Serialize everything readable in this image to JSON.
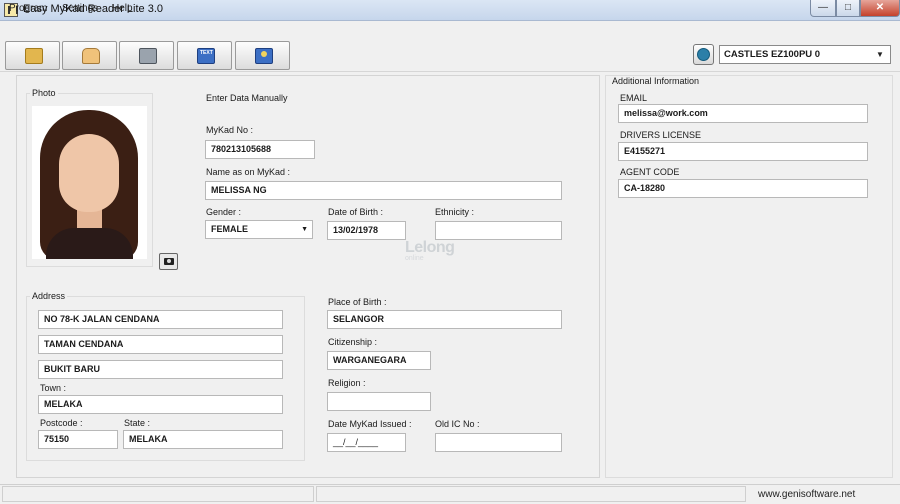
{
  "window": {
    "title": "Easy MyKad Reader Lite 3.0",
    "minimize": "—",
    "maximize": "□",
    "close": "✕"
  },
  "menu": [
    "Program",
    "Settings",
    "Help"
  ],
  "toolbar": {
    "buttons": [
      "card-reader-icon",
      "hand-card-icon",
      "printer-icon",
      "save-text-icon",
      "save-picture-icon"
    ],
    "save_text_glyph": "TEXT",
    "reader_select": "CASTLES EZ100PU 0"
  },
  "form": {
    "photo_label": "Photo",
    "enter_manually": "Enter Data Manually",
    "mykad_no_label": "MyKad No :",
    "mykad_no": "780213105688",
    "name_label": "Name as on MyKad :",
    "name": "MELISSA NG",
    "gender_label": "Gender :",
    "gender": "FEMALE",
    "dob_label": "Date of Birth :",
    "dob": "13/02/1978",
    "ethnicity_label": "Ethnicity :",
    "ethnicity": "",
    "address_label": "Address",
    "address1": "NO 78-K JALAN CENDANA",
    "address2": "TAMAN CENDANA",
    "address3": "BUKIT BARU",
    "town_label": "Town :",
    "town": "MELAKA",
    "postcode_label": "Postcode :",
    "postcode": "75150",
    "state_label": "State :",
    "state": "MELAKA",
    "pob_label": "Place of Birth :",
    "pob": "SELANGOR",
    "citizenship_label": "Citizenship :",
    "citizenship": "WARGANEGARA",
    "religion_label": "Religion :",
    "religion": "",
    "issued_label": "Date MyKad Issued :",
    "issued": "__/__/____",
    "oldic_label": "Old IC No :",
    "oldic": ""
  },
  "additional": {
    "title": "Additional Information",
    "email_label": "EMAIL",
    "email": "melissa@work.com",
    "license_label": "DRIVERS LICENSE",
    "license": "E4155271",
    "agent_label": "AGENT CODE",
    "agent": "CA-18280"
  },
  "watermark": {
    "main": "Lelong",
    "sub": "online"
  },
  "status": {
    "url": "www.genisoftware.net"
  }
}
